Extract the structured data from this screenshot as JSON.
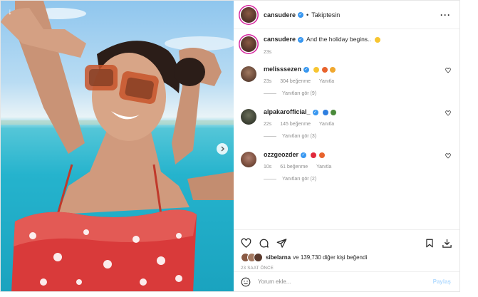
{
  "header": {
    "username": "cansudere",
    "follow_label": "Takiptesin",
    "separator": "•"
  },
  "caption": {
    "username": "cansudere",
    "text": "And the holiday begins..",
    "time": "23s"
  },
  "comments": [
    {
      "username": "melisssezen",
      "time": "23s",
      "likes": "304 beğenme",
      "reply": "Yanıtla",
      "view_replies": "Yanıtları gör (9)"
    },
    {
      "username": "alpakarofficial_",
      "time": "22s",
      "likes": "145 beğenme",
      "reply": "Yanıtla",
      "view_replies": "Yanıtları gör (3)"
    },
    {
      "username": "ozzgeozder",
      "time": "10s",
      "likes": "61 beğenme",
      "reply": "Yanıtla",
      "view_replies": "Yanıtları gör (2)"
    }
  ],
  "likes_line": {
    "user": "sibelarna",
    "rest": "ve 139,730 diğer kişi beğendi"
  },
  "post_time": "23 SAAT ÖNCE",
  "add_comment": {
    "placeholder": "Yorum ekle...",
    "post_label": "Paylaş"
  },
  "icons": {
    "emoji": "smile-icon",
    "like": "heart-icon",
    "comment": "comment-icon",
    "share": "send-icon",
    "save": "bookmark-icon"
  },
  "colors": {
    "verified": "#3897f0",
    "story_ring": "#d6249f",
    "post_button_disabled": "#b3dbff"
  }
}
